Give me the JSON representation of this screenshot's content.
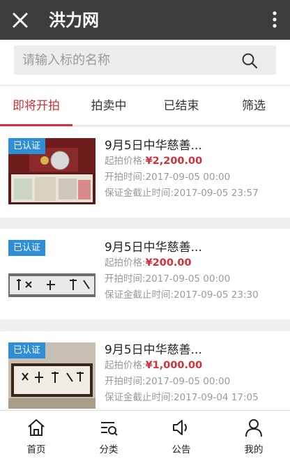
{
  "titlebar": {
    "title": "洪力网"
  },
  "search": {
    "placeholder": "请输入标的名称"
  },
  "tabs": [
    {
      "label": "即将开拍",
      "active": true
    },
    {
      "label": "拍卖中",
      "active": false
    },
    {
      "label": "已结束",
      "active": false
    },
    {
      "label": "筛选",
      "active": false
    }
  ],
  "items": [
    {
      "badge": "已认证",
      "title": "9月5日中华慈善...",
      "price_label": "起拍价格:",
      "price": "¥2,200.00",
      "start_label": "开拍时间:",
      "start_time": "2017-09-05 00:00",
      "deposit_label": "保证金截止时间:",
      "deposit_time": "2017-09-05 23:57"
    },
    {
      "badge": "已认证",
      "title": "9月5日中华慈善...",
      "price_label": "起拍价格:",
      "price": "¥200.00",
      "start_label": "开拍时间:",
      "start_time": "2017-09-05 00:00",
      "deposit_label": "保证金截止时间:",
      "deposit_time": "2017-09-05 23:30"
    },
    {
      "badge": "已认证",
      "title": "9月5日中华慈善...",
      "price_label": "起拍价格:",
      "price": "¥1,000.00",
      "start_label": "开拍时间:",
      "start_time": "2017-09-05 00:00",
      "deposit_label": "保证金截止时间:",
      "deposit_time": "2017-09-04 17:05"
    }
  ],
  "tabbar": [
    {
      "label": "首页",
      "icon": "home-icon"
    },
    {
      "label": "分类",
      "icon": "category-icon"
    },
    {
      "label": "公告",
      "icon": "megaphone-icon"
    },
    {
      "label": "我的",
      "icon": "user-icon"
    }
  ],
  "colors": {
    "accent": "#d3303a",
    "badge": "#2e8fd6",
    "titlebar": "#3d3d3d"
  }
}
